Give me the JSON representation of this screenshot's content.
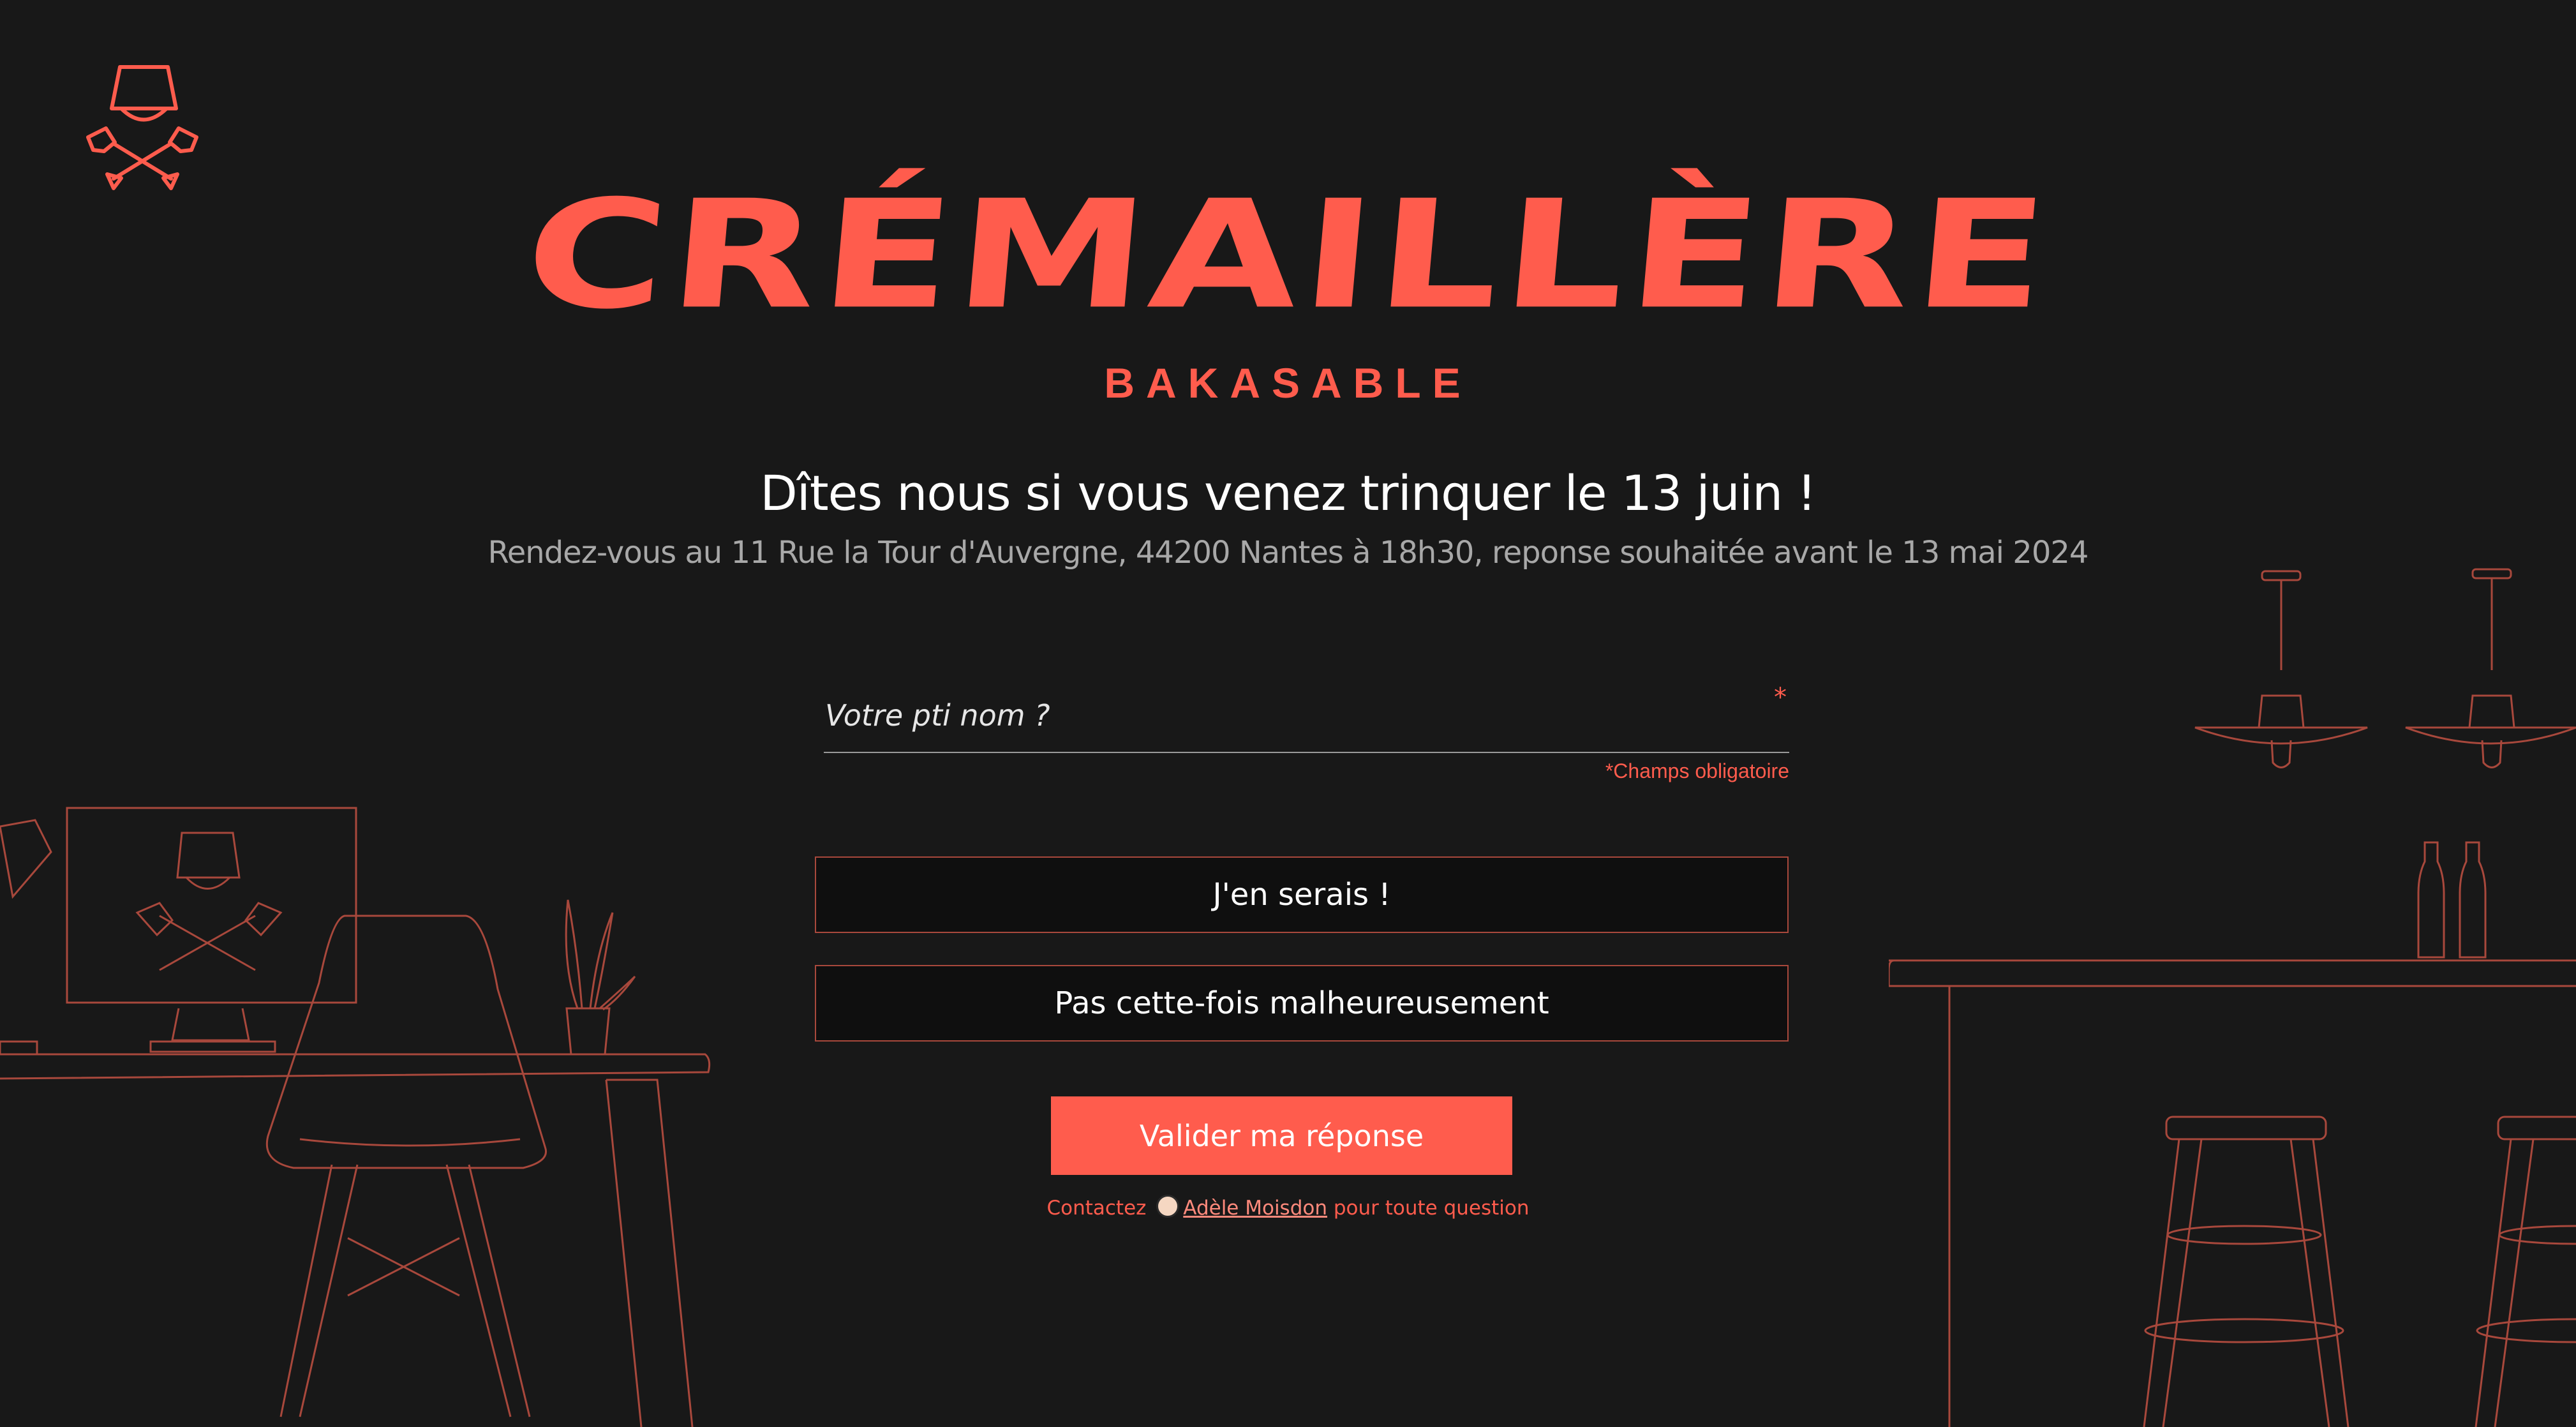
{
  "brand": {
    "title": "CRÉMAILLÈRE",
    "subtitle": "BAKASABLE"
  },
  "header": {
    "headline": "Dîtes nous si vous venez trinquer le 13 juin !",
    "details": "Rendez-vous au 11 Rue la Tour d'Auvergne, 44200 Nantes à 18h30, reponse souhaitée avant le 13 mai 2024"
  },
  "form": {
    "name_placeholder": "Votre pti nom ?",
    "name_value": "",
    "required_star": "*",
    "required_note": "*Champs obligatoire",
    "option_yes": "J'en serais !",
    "option_no": "Pas cette-fois malheureusement",
    "submit_label": "Valider ma réponse"
  },
  "contact": {
    "prefix": "Contactez",
    "name": "Adèle Moisdon",
    "suffix": "pour toute question"
  },
  "colors": {
    "background": "#181818",
    "accent": "#ff5c4d",
    "line_art": "#a8483c"
  },
  "icons": [
    "lamp-shovels-logo",
    "avatar-icon"
  ]
}
